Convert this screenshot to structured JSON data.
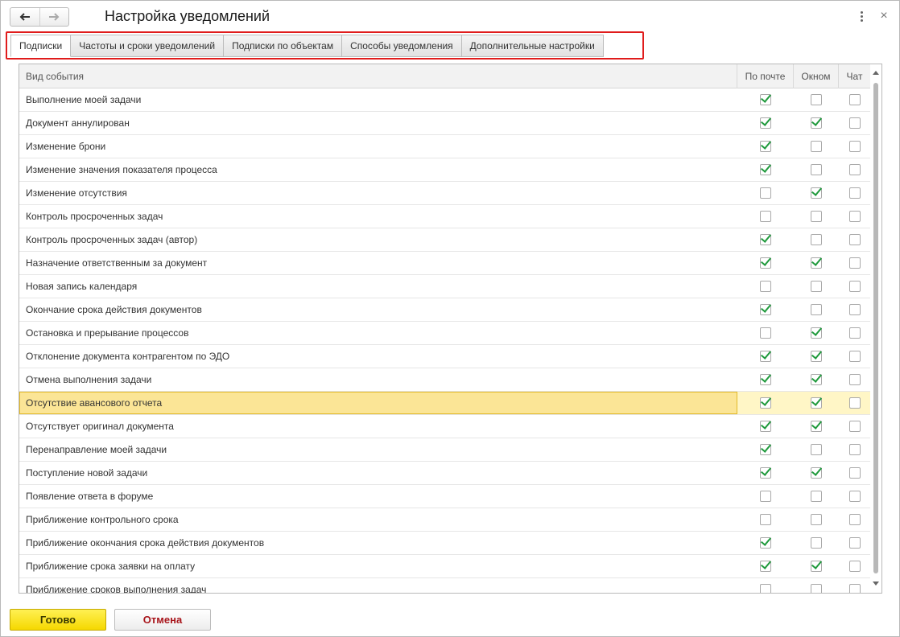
{
  "window": {
    "title": "Настройка уведомлений",
    "back_icon": "arrow-left-icon",
    "forward_icon": "arrow-right-icon",
    "more_icon": "vertical-dots-icon",
    "close_icon": "close-icon",
    "close_glyph": "×"
  },
  "tabs": [
    {
      "label": "Подписки",
      "active": true
    },
    {
      "label": "Частоты и сроки уведомлений",
      "active": false
    },
    {
      "label": "Подписки по объектам",
      "active": false
    },
    {
      "label": "Способы уведомления",
      "active": false
    },
    {
      "label": "Дополнительные настройки",
      "active": false
    }
  ],
  "table": {
    "columns": {
      "event": "Вид события",
      "mail": "По почте",
      "window": "Окном",
      "chat": "Чат"
    },
    "rows": [
      {
        "event": "Выполнение моей задачи",
        "mail": true,
        "window": false,
        "chat": false
      },
      {
        "event": "Документ аннулирован",
        "mail": true,
        "window": true,
        "chat": false
      },
      {
        "event": "Изменение брони",
        "mail": true,
        "window": false,
        "chat": false
      },
      {
        "event": "Изменение значения показателя процесса",
        "mail": true,
        "window": false,
        "chat": false
      },
      {
        "event": "Изменение отсутствия",
        "mail": false,
        "window": true,
        "chat": false
      },
      {
        "event": "Контроль просроченных задач",
        "mail": false,
        "window": false,
        "chat": false
      },
      {
        "event": "Контроль просроченных задач (автор)",
        "mail": true,
        "window": false,
        "chat": false
      },
      {
        "event": "Назначение ответственным за документ",
        "mail": true,
        "window": true,
        "chat": false
      },
      {
        "event": "Новая запись календаря",
        "mail": false,
        "window": false,
        "chat": false
      },
      {
        "event": "Окончание срока действия документов",
        "mail": true,
        "window": false,
        "chat": false
      },
      {
        "event": "Остановка и прерывание процессов",
        "mail": false,
        "window": true,
        "chat": false
      },
      {
        "event": "Отклонение документа контрагентом по ЭДО",
        "mail": true,
        "window": true,
        "chat": false
      },
      {
        "event": "Отмена выполнения задачи",
        "mail": true,
        "window": true,
        "chat": false
      },
      {
        "event": "Отсутствие авансового отчета",
        "mail": true,
        "window": true,
        "chat": false,
        "selected": true
      },
      {
        "event": "Отсутствует оригинал документа",
        "mail": true,
        "window": true,
        "chat": false
      },
      {
        "event": "Перенаправление моей задачи",
        "mail": true,
        "window": false,
        "chat": false
      },
      {
        "event": "Поступление новой задачи",
        "mail": true,
        "window": true,
        "chat": false
      },
      {
        "event": "Появление ответа в форуме",
        "mail": false,
        "window": false,
        "chat": false
      },
      {
        "event": "Приближение контрольного срока",
        "mail": false,
        "window": false,
        "chat": false
      },
      {
        "event": "Приближение окончания срока действия документов",
        "mail": true,
        "window": false,
        "chat": false
      },
      {
        "event": "Приближение срока заявки на оплату",
        "mail": true,
        "window": true,
        "chat": false
      },
      {
        "event": "Приближение сроков выполнения задач",
        "mail": false,
        "window": false,
        "chat": false
      }
    ]
  },
  "footer": {
    "ok_label": "Готово",
    "cancel_label": "Отмена"
  },
  "colors": {
    "accent_ok": "#f5d800",
    "cancel_text": "#a8151b",
    "check_green": "#1f9a3c",
    "highlight_red": "#e01c1c",
    "selected_row": "#fbe596"
  }
}
